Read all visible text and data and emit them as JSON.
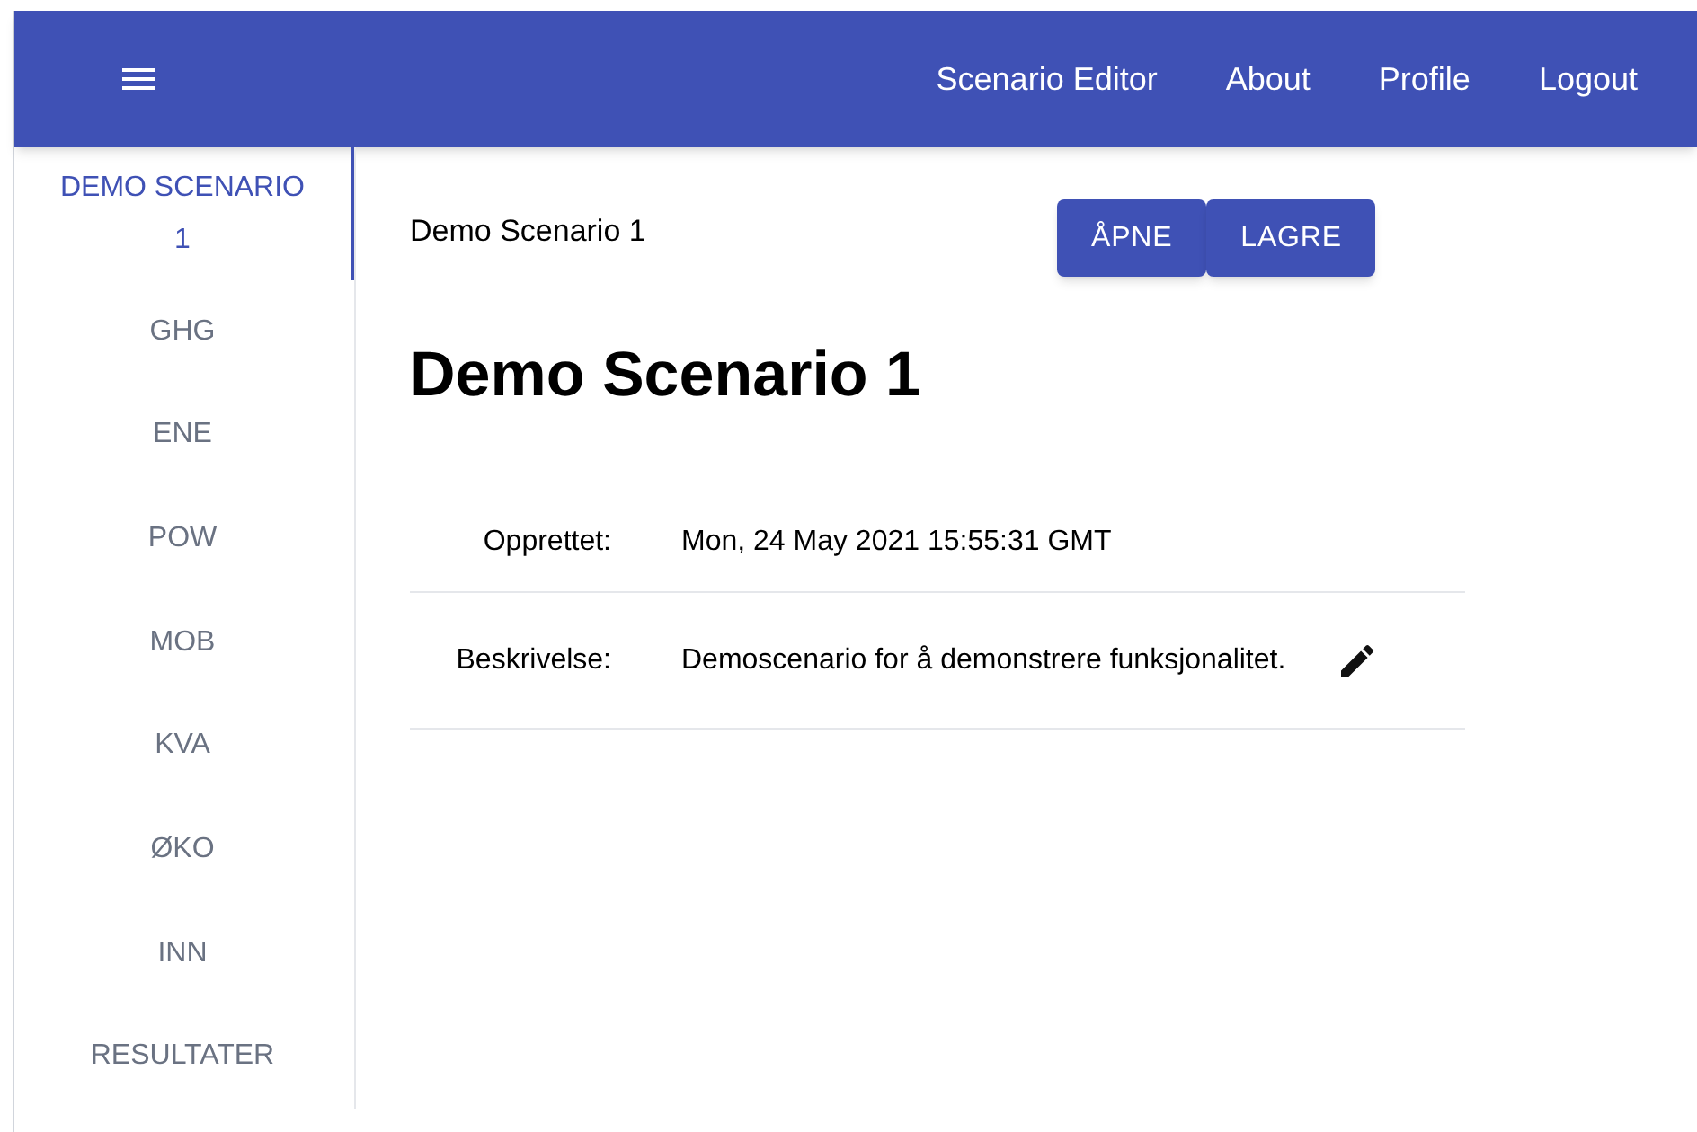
{
  "top_bar": {
    "nav_links": [
      "Scenario Editor",
      "About",
      "Profile",
      "Logout"
    ]
  },
  "sidebar": {
    "tabs": [
      {
        "label": "DEMO SCENARIO 1",
        "selected": true
      },
      {
        "label": "GHG",
        "selected": false
      },
      {
        "label": "ENE",
        "selected": false
      },
      {
        "label": "POW",
        "selected": false
      },
      {
        "label": "MOB",
        "selected": false
      },
      {
        "label": "KVA",
        "selected": false
      },
      {
        "label": "ØKO",
        "selected": false
      },
      {
        "label": "INN",
        "selected": false
      },
      {
        "label": "RESULTATER",
        "selected": false
      }
    ]
  },
  "header": {
    "scenario_name": "Demo Scenario 1",
    "buttons": [
      "ÅPNE",
      "LAGRE"
    ]
  },
  "title": "Demo Scenario 1",
  "details": [
    {
      "label": "Opprettet:",
      "value": "Mon, 24 May 2021 15:55:31 GMT",
      "editable": false
    },
    {
      "label": "Beskrivelse:",
      "value": "Demoscenario for å demonstrere funksjonalitet.",
      "editable": true
    }
  ]
}
